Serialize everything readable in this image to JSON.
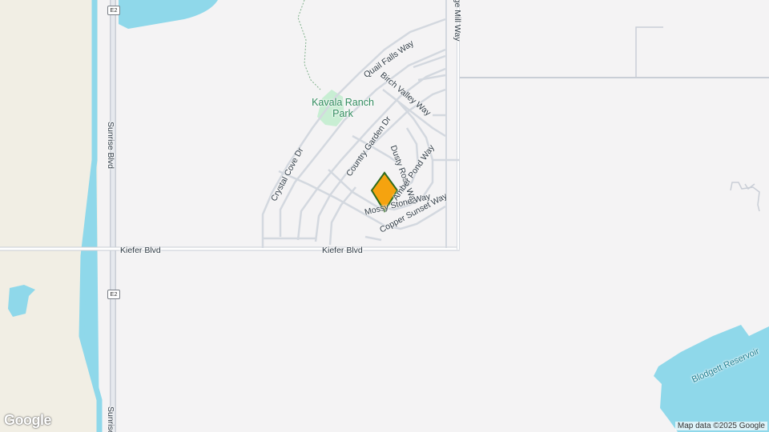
{
  "map": {
    "park_name": "Kavala Ranch Park",
    "water_label": "Blodgett Reservoir",
    "route_shield": "E2",
    "attribution": "Map data ©2025 Google",
    "logo": "Google",
    "pin_color": "#f5a30f",
    "pin_outline": "#2e6b1f",
    "water_color": "#8fd8ea",
    "park_color": "#c8eed3",
    "farmland_color": "#f1eee4",
    "roads": {
      "sunrise_top": "Sunrise Blvd",
      "sunrise_bottom": "Sunrise B",
      "kiefer_west": "Kiefer Blvd",
      "kiefer_east": "Kiefer Blvd",
      "village_mill": "Village Mill Way",
      "quail_falls": "Quail Falls Way",
      "birch_valley": "Birch Valley Way",
      "crystal_cove": "Crystal Cove Dr",
      "country_garden": "Country Garden Dr",
      "dusty_rose": "Dusty Rose Way",
      "amber_pond": "Amber Pond Way",
      "mossy_stone": "Mossy Stone Way",
      "copper_sunset": "Copper Sunset Way"
    }
  }
}
